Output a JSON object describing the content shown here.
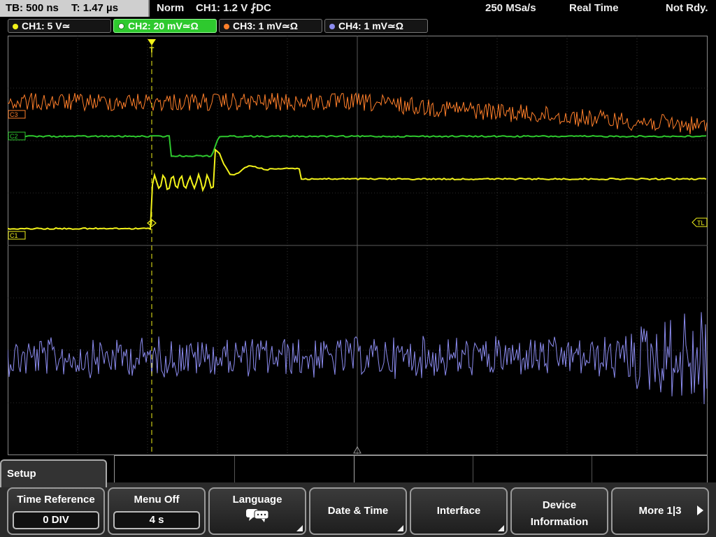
{
  "status": {
    "timebase": "TB: 500 ns",
    "trigger_time": "T: 1.47 µs",
    "mode": "Norm",
    "trigger_setting": "CH1: 1.2 V ⨏DC",
    "sample_rate": "250 MSa/s",
    "acq_mode": "Real Time",
    "state": "Not Rdy."
  },
  "channels": [
    {
      "label": "CH1: 5 V≃",
      "color": "#f2f21a",
      "active": false
    },
    {
      "label": "CH2: 20 mV≃Ω",
      "color": "#2ec92e",
      "active": true
    },
    {
      "label": "CH3: 1 mV≃Ω",
      "color": "#ff7f2a",
      "active": false
    },
    {
      "label": "CH4: 1 mV≃Ω",
      "color": "#8c8cf0",
      "active": false
    }
  ],
  "markers": {
    "c1": "C1",
    "c2": "C2",
    "c3": "C3",
    "trigger_level": "TL",
    "trigger_pos": "T"
  },
  "menu": {
    "title": "Setup",
    "time_reference": {
      "label": "Time Reference",
      "value": "0 DIV"
    },
    "menu_off": {
      "label": "Menu Off",
      "value": "4 s"
    },
    "language": {
      "label": "Language",
      "icon": "speech-bubbles-icon"
    },
    "date_time": {
      "label": "Date & Time"
    },
    "interface": {
      "label": "Interface"
    },
    "device_information": {
      "line1": "Device",
      "line2": "Information"
    },
    "more": {
      "label": "More 1|3"
    }
  },
  "colors": {
    "ch1": "#f2f21a",
    "ch2": "#2ec92e",
    "ch3": "#ff7f2a",
    "ch4": "#8c8cf0",
    "grid": "#5a5a5a"
  }
}
